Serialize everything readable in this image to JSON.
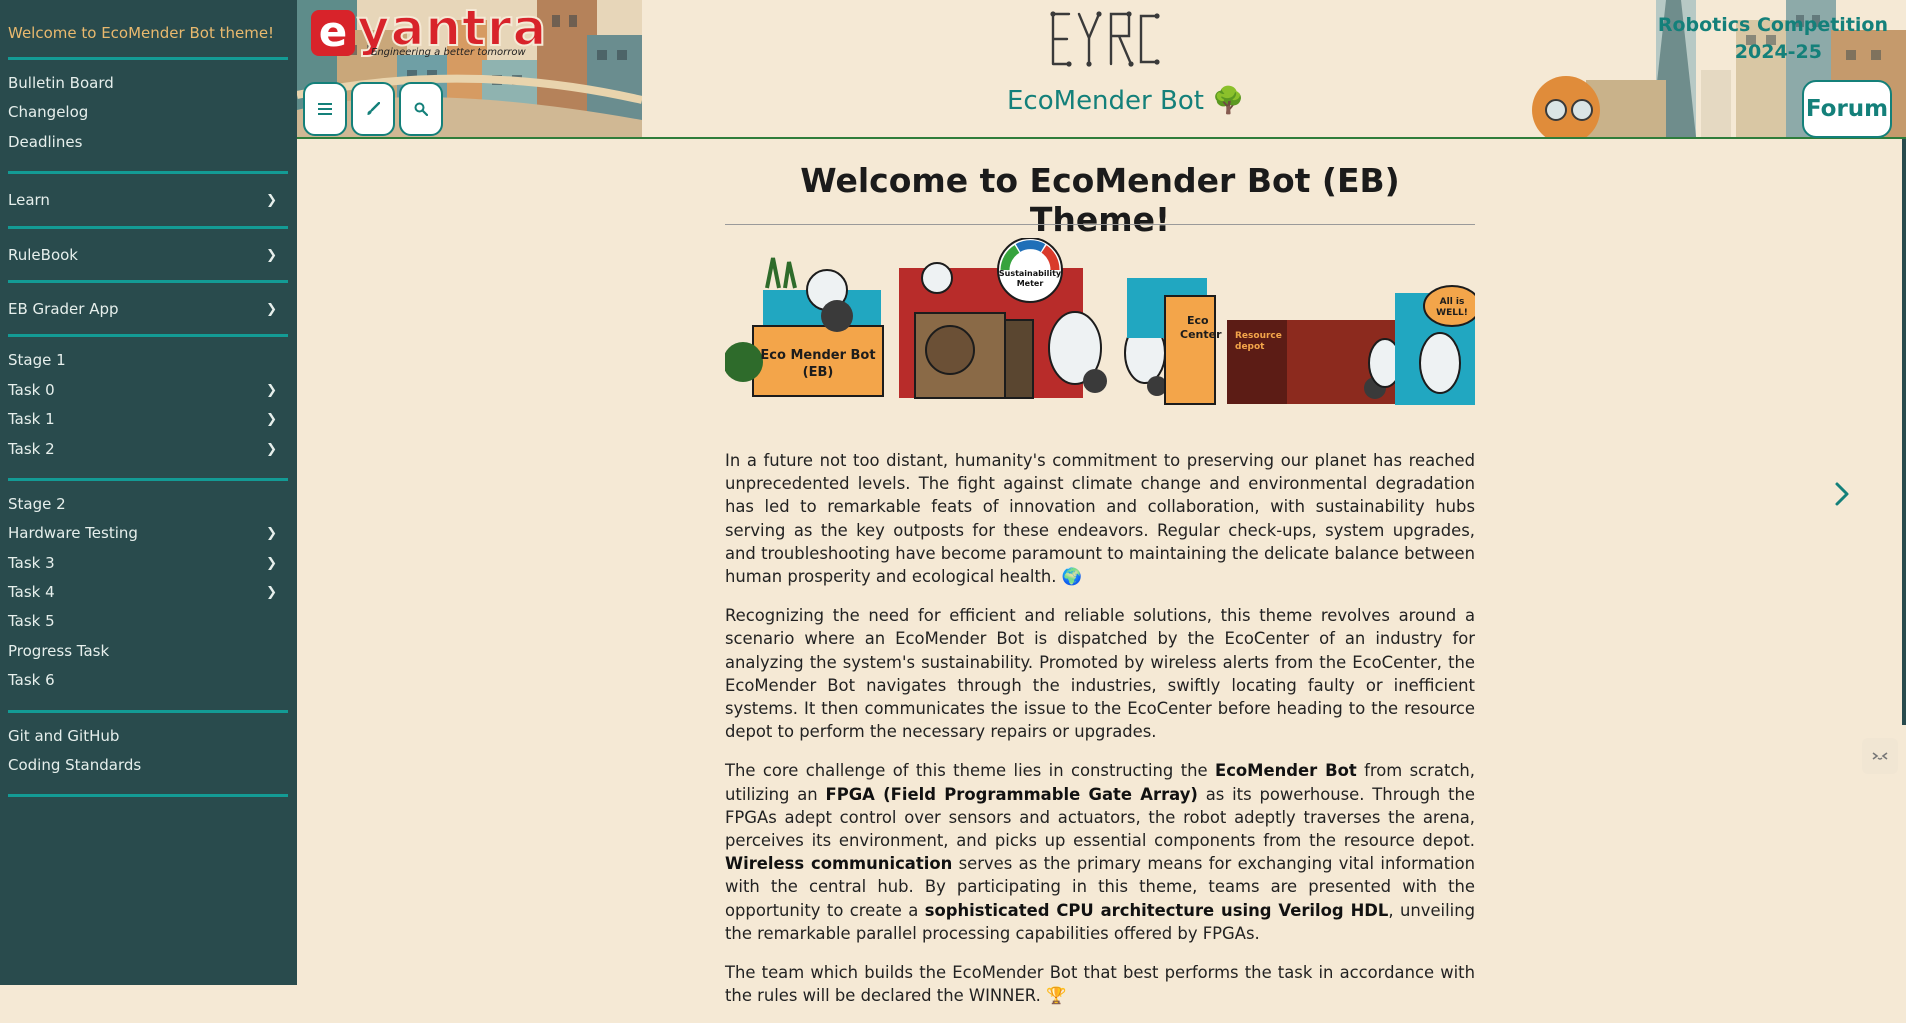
{
  "sidebar": {
    "welcome": "Welcome to EcoMender Bot theme!",
    "group1": [
      {
        "label": "Bulletin Board"
      },
      {
        "label": "Changelog"
      },
      {
        "label": "Deadlines"
      }
    ],
    "learn": "Learn",
    "rulebook": "RuleBook",
    "grader": "EB Grader App",
    "stage1": [
      {
        "label": "Stage 1"
      },
      {
        "label": "Task 0"
      },
      {
        "label": "Task 1"
      },
      {
        "label": "Task 2"
      }
    ],
    "stage2": [
      {
        "label": "Stage 2"
      },
      {
        "label": "Hardware Testing"
      },
      {
        "label": "Task 3"
      },
      {
        "label": "Task 4"
      },
      {
        "label": "Task 5"
      },
      {
        "label": "Progress Task"
      },
      {
        "label": "Task 6"
      }
    ],
    "misc": [
      {
        "label": "Git and GitHub"
      },
      {
        "label": "Coding Standards"
      }
    ],
    "chevron": "❯"
  },
  "header": {
    "logo_letter": "e",
    "logo_word": "yantra",
    "logo_tagline": "Engineering a better tomorrow",
    "site_title": "EcoMender Bot 🌳",
    "competition_line1": "Robotics Competition",
    "competition_line2": "2024-25",
    "forum_label": "Forum",
    "toolbar_icons": [
      "menu-icon",
      "brush-icon",
      "search-icon"
    ]
  },
  "main": {
    "title": "Welcome to EcoMender Bot (EB) Theme!",
    "banner": {
      "eb_label_1": "Eco Mender Bot",
      "eb_label_2": "(EB)",
      "meter_1": "Sustainability",
      "meter_2": "Meter",
      "eco_1": "Eco",
      "eco_2": "Center",
      "depot_1": "Resource",
      "depot_2": "depot",
      "bubble_1": "All is",
      "bubble_2": "WELL!"
    },
    "p1": "In a future not too distant, humanity's commitment to preserving our planet has reached unprecedented levels. The fight against climate change and environmental degradation has led to remarkable feats of innovation and collaboration, with sustainability hubs serving as the key outposts for these endeavors. Regular check-ups, system upgrades, and troubleshooting have become paramount to maintaining the delicate balance between human prosperity and ecological health. 🌍",
    "p2": "Recognizing the need for efficient and reliable solutions, this theme revolves around a scenario where an EcoMender Bot is dispatched by the EcoCenter of an industry for analyzing the system's sustainability. Promoted by wireless alerts from the EcoCenter, the EcoMender Bot navigates through the industries, swiftly locating faulty or inefficient systems. It then communicates the issue to the EcoCenter before heading to the resource depot to perform the necessary repairs or upgrades.",
    "p3": {
      "t1": "The core challenge of this theme lies in constructing the ",
      "b1": "EcoMender Bot",
      "t2": " from scratch, utilizing an ",
      "b2": "FPGA (Field Programmable Gate Array)",
      "t3": " as its powerhouse. Through the FPGAs adept control over sensors and actuators, the robot adeptly traverses the arena, perceives its environment, and picks up essential components from the resource depot. ",
      "b3": "Wireless communication",
      "t4": " serves as the primary means for exchanging vital information with the central hub. By participating in this theme, teams are presented with the opportunity to create a ",
      "b4": "sophisticated CPU architecture using Verilog HDL",
      "t5": ", unveiling the remarkable parallel processing capabilities offered by FPGAs."
    },
    "p4": "The team which builds the EcoMender Bot that best performs the task in accordance with the rules will be declared the WINNER. 🏆"
  }
}
